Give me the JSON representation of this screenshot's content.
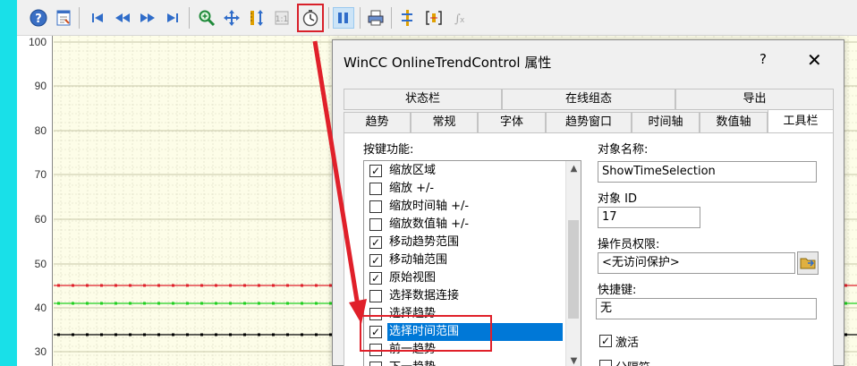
{
  "toolbar": {
    "buttons": [
      {
        "name": "help-icon"
      },
      {
        "name": "config-dialog-icon"
      },
      {
        "name": "first-record-icon"
      },
      {
        "name": "previous-record-icon"
      },
      {
        "name": "next-record-icon"
      },
      {
        "name": "last-record-icon"
      },
      {
        "name": "zoom-area-icon"
      },
      {
        "name": "move-trend-area-icon"
      },
      {
        "name": "move-axis-icon"
      },
      {
        "name": "original-view-icon"
      },
      {
        "name": "select-time-range-icon"
      },
      {
        "name": "stop-start-icon"
      },
      {
        "name": "print-icon"
      },
      {
        "name": "ruler-icon"
      },
      {
        "name": "statistics-area-icon"
      },
      {
        "name": "statistics-icon"
      }
    ]
  },
  "chart": {
    "y_ticks": [
      "100",
      "90",
      "80",
      "70",
      "60",
      "50",
      "40",
      "30"
    ],
    "colors": {
      "red": "#e0202a",
      "green": "#20d020",
      "black": "#000000",
      "grid": "#d8d8c0",
      "background": "#fdfde8"
    }
  },
  "dialog": {
    "title": "WinCC OnlineTrendControl 属性",
    "help": "?",
    "close": "✕",
    "tabs_row1": [
      "状态栏",
      "在线组态",
      "导出"
    ],
    "tabs_row2": [
      "趋势",
      "常规",
      "字体",
      "趋势窗口",
      "时间轴",
      "数值轴",
      "工具栏"
    ],
    "selected_tab": "工具栏",
    "key_functions_label": "按键功能:",
    "key_functions": [
      {
        "label": "缩放区域",
        "checked": true
      },
      {
        "label": "缩放 +/-",
        "checked": false
      },
      {
        "label": "缩放时间轴 +/-",
        "checked": false
      },
      {
        "label": "缩放数值轴 +/-",
        "checked": false
      },
      {
        "label": "移动趋势范围",
        "checked": true
      },
      {
        "label": "移动轴范围",
        "checked": true
      },
      {
        "label": "原始视图",
        "checked": true
      },
      {
        "label": "选择数据连接",
        "checked": false
      },
      {
        "label": "选择趋势",
        "checked": false
      },
      {
        "label": "选择时间范围",
        "checked": true,
        "selected": true
      },
      {
        "label": "前一趋势",
        "checked": false
      },
      {
        "label": "下一趋势",
        "checked": false
      }
    ],
    "object_name_label": "对象名称:",
    "object_name_value": "ShowTimeSelection",
    "object_id_label": "对象 ID",
    "object_id_value": "17",
    "operator_rights_label": "操作员权限:",
    "operator_rights_value": "<无访问保护>",
    "hotkey_label": "快捷键:",
    "hotkey_value": "无",
    "activate_label": "激活",
    "activate_checked": true,
    "separator_label": "分隔符",
    "separator_checked": false
  }
}
